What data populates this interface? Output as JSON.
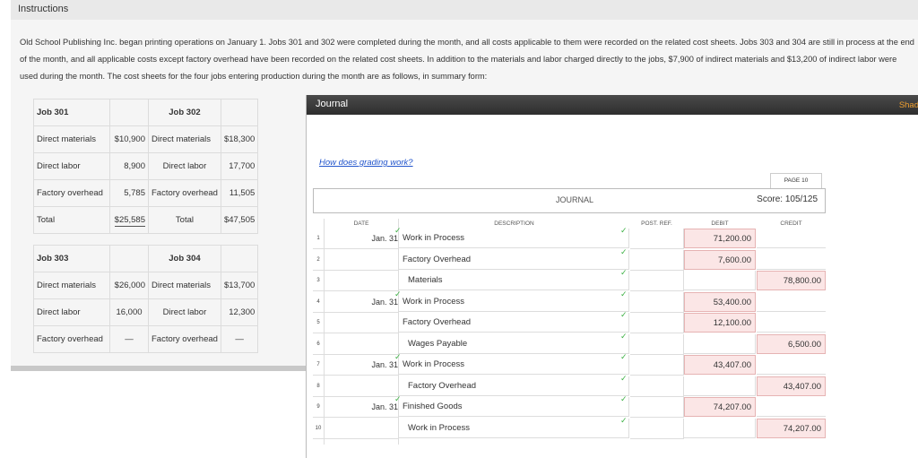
{
  "header": {
    "title": "Instructions"
  },
  "instructions": "Old School Publishing Inc. began printing operations on January 1. Jobs 301 and 302 were completed during the month, and all costs applicable to them were recorded on the related cost sheets. Jobs 303 and 304 are still in process at the end of the month, and all applicable costs except factory overhead have been recorded on the related cost sheets. In addition to the materials and labor charged directly to the jobs, $7,900 of indirect materials and $13,200 of indirect labor were used during the month. The cost sheets for the four jobs entering production during the month are as follows, in summary form:",
  "cost_sheets": {
    "table1": {
      "jobA": "Job 301",
      "jobB": "Job 302",
      "rows": [
        {
          "label": "Direct materials",
          "a": "$10,900",
          "blabel": "Direct materials",
          "b": "$18,300"
        },
        {
          "label": "Direct labor",
          "a": "8,900",
          "blabel": "Direct labor",
          "b": "17,700"
        },
        {
          "label": "Factory overhead",
          "a": "5,785",
          "blabel": "Factory overhead",
          "b": "11,505"
        },
        {
          "label": "Total",
          "a": "$25,585",
          "blabel": "Total",
          "b": "$47,505"
        }
      ]
    },
    "table2": {
      "jobA": "Job 303",
      "jobB": "Job 304",
      "rows": [
        {
          "label": "Direct materials",
          "a": "$26,000",
          "blabel": "Direct materials",
          "b": "$13,700"
        },
        {
          "label": "Direct labor",
          "a": "16,000",
          "blabel": "Direct labor",
          "b": "12,300"
        },
        {
          "label": "Factory overhead",
          "a": "—",
          "blabel": "Factory overhead",
          "b": "—"
        }
      ]
    }
  },
  "journal": {
    "title": "Journal",
    "shade_label": "Shad",
    "grading_link": "How does grading work?",
    "page_label": "PAGE 10",
    "journal_label": "JOURNAL",
    "score": "Score: 105/125",
    "columns": {
      "date": "DATE",
      "description": "DESCRIPTION",
      "post_ref": "POST. REF.",
      "debit": "DEBIT",
      "credit": "CREDIT"
    },
    "rows": [
      {
        "num": "1",
        "date": "Jan. 31",
        "desc": "Work in Process",
        "debit": "71,200.00",
        "credit": ""
      },
      {
        "num": "2",
        "date": "",
        "desc": "Factory Overhead",
        "debit": "7,600.00",
        "credit": ""
      },
      {
        "num": "3",
        "date": "",
        "desc": "Materials",
        "debit": "",
        "credit": "78,800.00"
      },
      {
        "num": "4",
        "date": "Jan. 31",
        "desc": "Work in Process",
        "debit": "53,400.00",
        "credit": ""
      },
      {
        "num": "5",
        "date": "",
        "desc": "Factory Overhead",
        "debit": "12,100.00",
        "credit": ""
      },
      {
        "num": "6",
        "date": "",
        "desc": "Wages Payable",
        "debit": "",
        "credit": "6,500.00"
      },
      {
        "num": "7",
        "date": "Jan. 31",
        "desc": "Work in Process",
        "debit": "43,407.00",
        "credit": ""
      },
      {
        "num": "8",
        "date": "",
        "desc": "Factory Overhead",
        "debit": "",
        "credit": "43,407.00"
      },
      {
        "num": "9",
        "date": "Jan. 31",
        "desc": "Finished Goods",
        "debit": "74,207.00",
        "credit": ""
      },
      {
        "num": "10",
        "date": "",
        "desc": "Work in Process",
        "debit": "",
        "credit": "74,207.00"
      }
    ]
  }
}
